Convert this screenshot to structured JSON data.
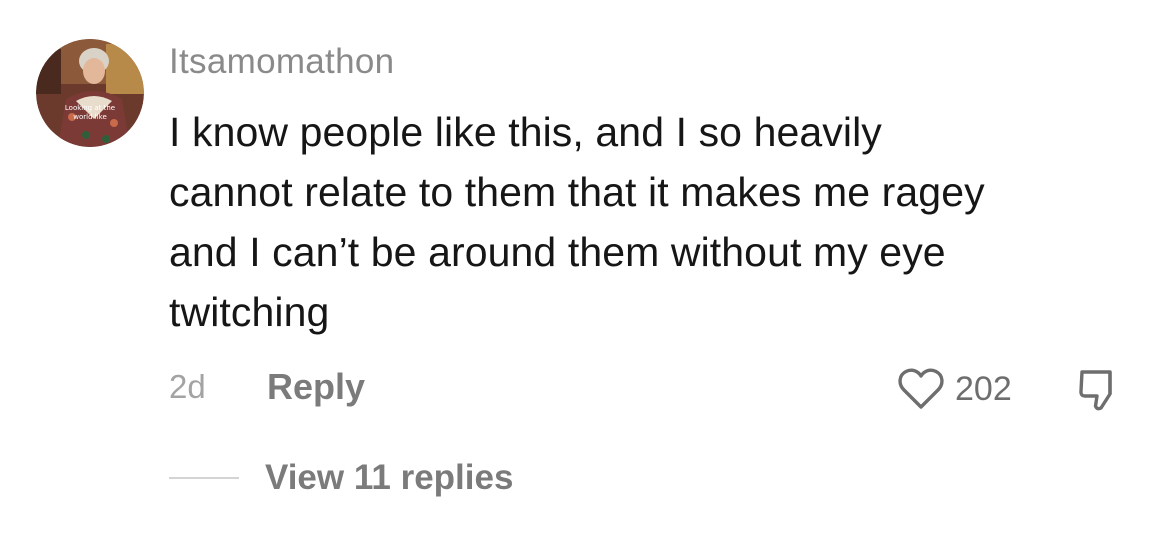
{
  "comment": {
    "username": "Itsamomathon",
    "avatar_caption": "Looking at the world like",
    "text_lines": [
      "I know people like this, and I so heavily",
      "cannot relate to them that it makes me ragey",
      "and I can’t be around them without my eye",
      "twitching"
    ],
    "timestamp": "2d",
    "reply_label": "Reply",
    "like_count": "202",
    "like_icon": "heart-outline-icon",
    "dislike_icon": "thumbs-down-icon"
  },
  "replies": {
    "view_label": "View 11 replies"
  },
  "colors": {
    "username": "#8a8a8a",
    "text": "#161616",
    "muted": "#7b7b7b",
    "timestamp": "#a3a3a3"
  }
}
